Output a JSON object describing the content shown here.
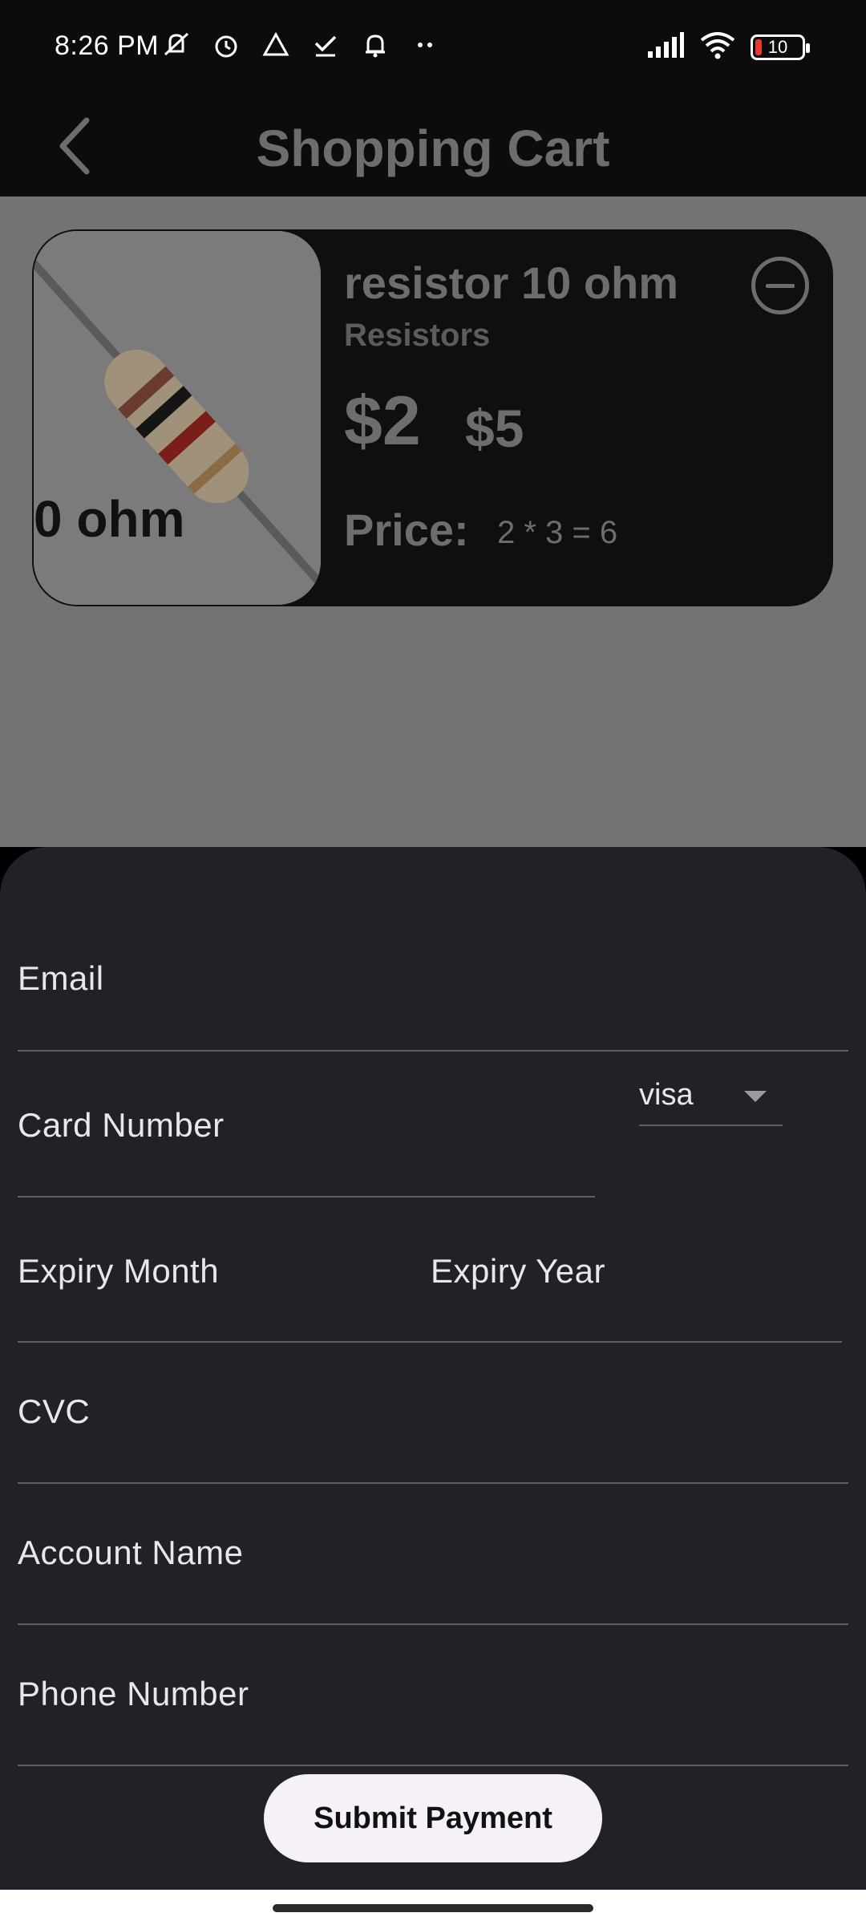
{
  "status_bar": {
    "time": "8:26 PM",
    "battery_level": "10",
    "icons_left": [
      "mute-vibrate-icon",
      "alarm-icon",
      "drive-icon",
      "task-check-icon",
      "bell-icon",
      "more-dots-icon"
    ],
    "icons_right": [
      "signal-icon",
      "wifi-icon",
      "battery-icon"
    ]
  },
  "app_bar": {
    "title": "Shopping Cart",
    "back_icon": "chevron-left-icon"
  },
  "cart": {
    "items": [
      {
        "name": "resistor 10 ohm",
        "category": "Resistors",
        "price_now": "$2",
        "price_old": "$5",
        "price_label": "Price:",
        "price_calc": "2 * 3 = 6",
        "image_text": "0 ohm",
        "remove_icon": "minus-circle-icon"
      }
    ]
  },
  "payment_form": {
    "email_label": "Email",
    "card_number_label": "Card Number",
    "card_type_value": "visa",
    "expiry_month_label": "Expiry Month",
    "expiry_year_label": "Expiry Year",
    "cvc_label": "CVC",
    "account_name_label": "Account Name",
    "phone_number_label": "Phone Number",
    "submit_label": "Submit Payment"
  },
  "colors": {
    "sheet_background": "#212227",
    "overlay": "#737373",
    "button_background": "#f6f0f8",
    "app_bar_background": "#0c0c0c"
  }
}
